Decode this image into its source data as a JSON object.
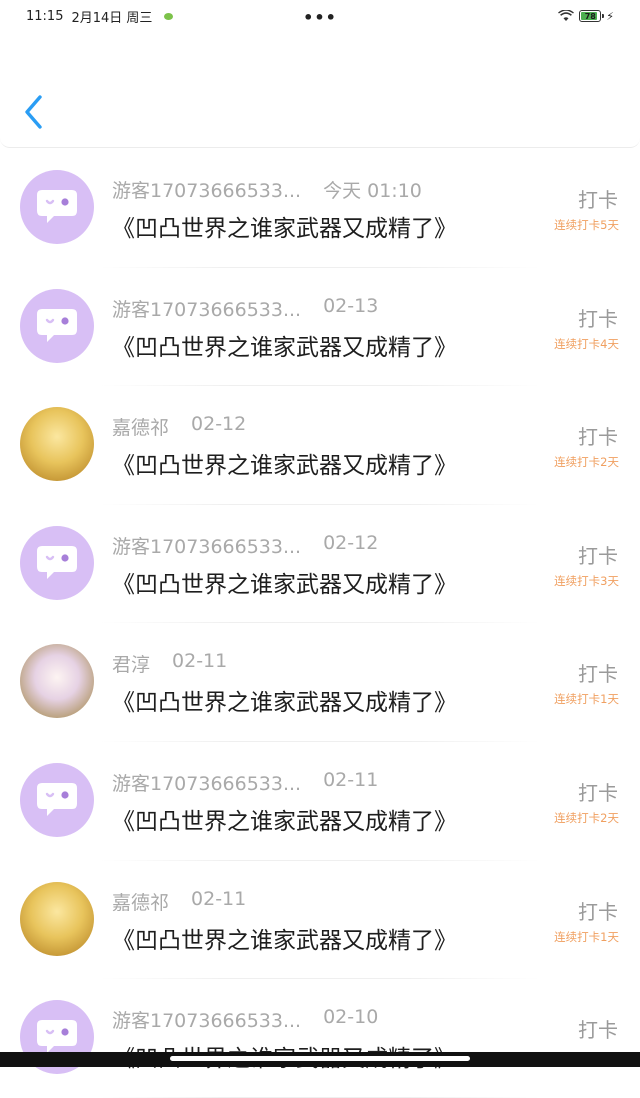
{
  "status": {
    "time": "11:15",
    "date": "2月14日 周三",
    "more": "•••",
    "battery": "78"
  },
  "list": [
    {
      "avatar": "guest",
      "user": "游客17073666533...",
      "date": "今天 01:10",
      "title": "《凹凸世界之谁家武器又成精了》",
      "action": "打卡",
      "streak": "连续打卡5天"
    },
    {
      "avatar": "guest",
      "user": "游客17073666533...",
      "date": "02-13",
      "title": "《凹凸世界之谁家武器又成精了》",
      "action": "打卡",
      "streak": "连续打卡4天"
    },
    {
      "avatar": "pic-a",
      "user": "嘉德祁",
      "date": "02-12",
      "title": "《凹凸世界之谁家武器又成精了》",
      "action": "打卡",
      "streak": "连续打卡2天"
    },
    {
      "avatar": "guest",
      "user": "游客17073666533...",
      "date": "02-12",
      "title": "《凹凸世界之谁家武器又成精了》",
      "action": "打卡",
      "streak": "连续打卡3天"
    },
    {
      "avatar": "pic-b",
      "user": "君淳",
      "date": "02-11",
      "title": "《凹凸世界之谁家武器又成精了》",
      "action": "打卡",
      "streak": "连续打卡1天"
    },
    {
      "avatar": "guest",
      "user": "游客17073666533...",
      "date": "02-11",
      "title": "《凹凸世界之谁家武器又成精了》",
      "action": "打卡",
      "streak": "连续打卡2天"
    },
    {
      "avatar": "pic-a",
      "user": "嘉德祁",
      "date": "02-11",
      "title": "《凹凸世界之谁家武器又成精了》",
      "action": "打卡",
      "streak": "连续打卡1天"
    },
    {
      "avatar": "guest",
      "user": "游客17073666533...",
      "date": "02-10",
      "title": "《凹凸世界之谁家武器又成精了》",
      "action": "打卡",
      "streak": ""
    }
  ],
  "icons": {
    "back": "chevron-left-icon",
    "guest_avatar": "chat-bubble-face-icon"
  },
  "colors": {
    "accent": "#2a9df4",
    "guest_avatar_bg": "#d8bff5",
    "streak": "#f0a061"
  }
}
